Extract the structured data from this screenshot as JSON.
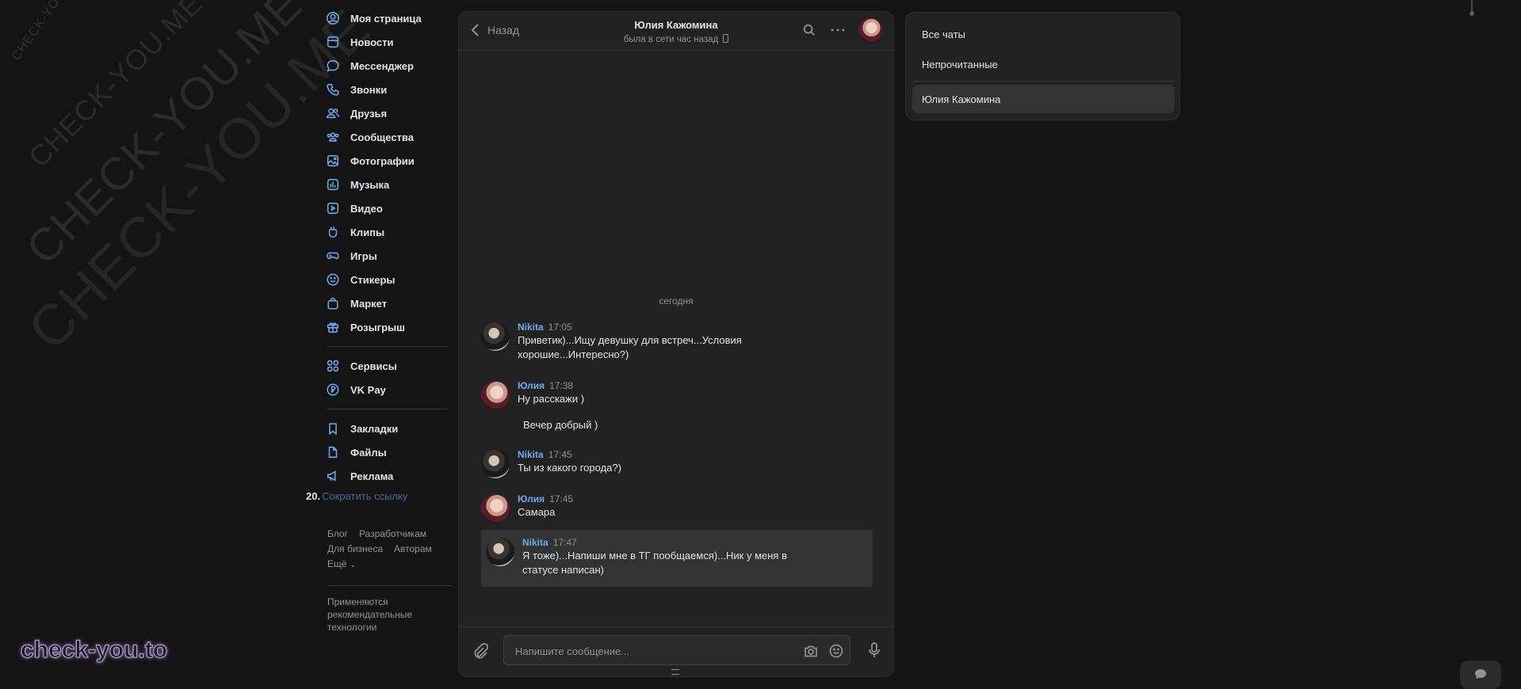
{
  "watermark": {
    "small": "CHECK-YOU.ME",
    "medium": "CHECK-YOU.ME",
    "large": "CHECK-YOU.ME",
    "xlarge": "CHECK-YOU.ME",
    "brand": "check-you.to"
  },
  "nav": {
    "items": [
      {
        "label": "Моя страница",
        "icon": "user-circle-icon"
      },
      {
        "label": "Новости",
        "icon": "news-icon"
      },
      {
        "label": "Мессенджер",
        "icon": "message-icon"
      },
      {
        "label": "Звонки",
        "icon": "phone-icon"
      },
      {
        "label": "Друзья",
        "icon": "friends-icon"
      },
      {
        "label": "Сообщества",
        "icon": "communities-icon"
      },
      {
        "label": "Фотографии",
        "icon": "photo-icon"
      },
      {
        "label": "Музыка",
        "icon": "music-icon"
      },
      {
        "label": "Видео",
        "icon": "video-icon"
      },
      {
        "label": "Клипы",
        "icon": "clips-icon"
      },
      {
        "label": "Игры",
        "icon": "gamepad-icon"
      },
      {
        "label": "Стикеры",
        "icon": "smile-icon"
      },
      {
        "label": "Маркет",
        "icon": "bag-icon"
      },
      {
        "label": "Розыгрыш",
        "icon": "gift-icon"
      }
    ],
    "items2": [
      {
        "label": "Сервисы",
        "icon": "services-icon"
      },
      {
        "label": "VK Pay",
        "icon": "rouble-icon"
      }
    ],
    "items3": [
      {
        "label": "Закладки",
        "icon": "bookmark-icon"
      },
      {
        "label": "Файлы",
        "icon": "file-icon"
      },
      {
        "label": "Реклама",
        "icon": "megaphone-icon"
      }
    ],
    "short_number": "20.",
    "short_link": "Сократить ссылку"
  },
  "footer": {
    "links": [
      "Блог",
      "Разработчикам",
      "Для бизнеса",
      "Авторам",
      "Ещё"
    ],
    "note": "Применяются рекомендательные технологии"
  },
  "chat": {
    "back_label": "Назад",
    "title": "Юлия Кажомина",
    "status": "была в сети час назад",
    "date_separator": "сегодня",
    "messages": [
      {
        "author": "Nikita",
        "time": "17:05",
        "text": "Приветик)...Ищу девушку для встреч...Условия хорошие...Интересно?)",
        "avatar": "nikita"
      },
      {
        "author": "Юлия",
        "time": "17:38",
        "text": "Ну расскажи )",
        "extra": "Вечер добрый )",
        "avatar": "yulia"
      },
      {
        "author": "Nikita",
        "time": "17:45",
        "text": "Ты из какого города?)",
        "avatar": "nikita"
      },
      {
        "author": "Юлия",
        "time": "17:45",
        "text": "Самара",
        "avatar": "yulia"
      },
      {
        "author": "Nikita",
        "time": "17:47",
        "text": "Я тоже)...Напиши мне в ТГ пообщаемся)...Ник у меня в статусе написан)",
        "avatar": "nikita"
      }
    ],
    "input_placeholder": "Напишите сообщение..."
  },
  "side": {
    "items": [
      "Все чаты",
      "Непрочитанные",
      "Юлия Кажомина"
    ]
  },
  "colors": {
    "accent": "#71aaeb",
    "background": "#141414",
    "panel": "#222222"
  }
}
